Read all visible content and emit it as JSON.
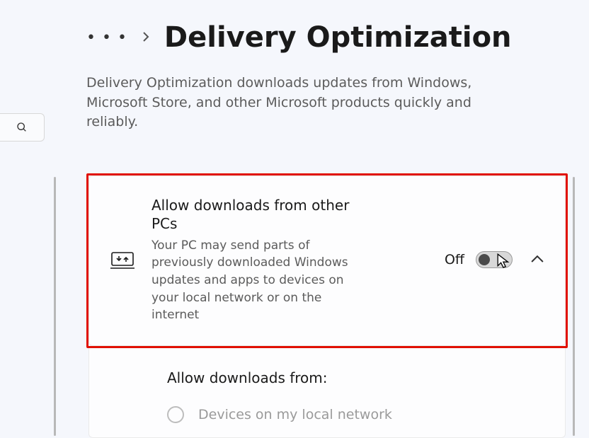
{
  "breadcrumb": {
    "title": "Delivery Optimization"
  },
  "description": "Delivery Optimization downloads updates from Windows, Microsoft Store, and other Microsoft products quickly and reliably.",
  "card": {
    "title": "Allow downloads from other PCs",
    "subtitle": "Your PC may send parts of previously downloaded Windows updates and apps to devices on your local network or on the internet",
    "toggleState": "Off"
  },
  "panel": {
    "title": "Allow downloads from:",
    "options": [
      {
        "label": "Devices on my local network"
      }
    ]
  }
}
